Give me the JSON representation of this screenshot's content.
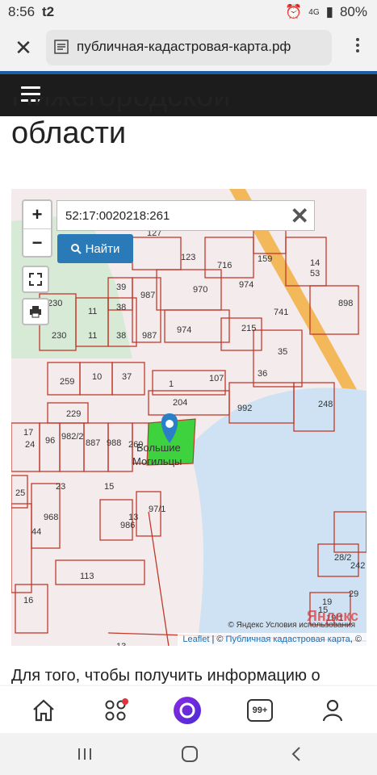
{
  "status": {
    "time": "8:56",
    "carrier": "t2",
    "battery": "80%",
    "net": "4G"
  },
  "browser": {
    "url": "публичная-кадастровая-карта.рф"
  },
  "heading": {
    "line1": "Нижегородской",
    "line2": "области"
  },
  "map": {
    "search_value": "52:17:0020218:261",
    "find_label": "Найти",
    "zoom_in": "+",
    "zoom_out": "−",
    "parcel_label_1": "Большие",
    "parcel_label_2": "Могильцы",
    "attrib_leaflet": "Leaflet",
    "attrib_sep": " | © ",
    "attrib_pkk": "Публичная кадастровая карта",
    "attrib_end": ", ©",
    "yandex_logo": "Яндекс",
    "yandex_copy": "© Яндекс  Условия использования",
    "plot_numbers": [
      "127",
      "123",
      "716",
      "159",
      "14",
      "53",
      "970",
      "974",
      "898",
      "39",
      "230",
      "11",
      "38",
      "987",
      "974",
      "215",
      "741",
      "35",
      "230",
      "11",
      "38",
      "987",
      "259",
      "10",
      "37",
      "1",
      "107",
      "36",
      "204",
      "992",
      "248",
      "229",
      "17",
      "24",
      "96",
      "982/2",
      "887",
      "988",
      "260",
      "25",
      "23",
      "15",
      "968",
      "13",
      "97/1",
      "44",
      "986",
      "113",
      "16",
      "28/2",
      "242",
      "29",
      "19",
      "19/1",
      "13",
      "15"
    ]
  },
  "article": {
    "text": "Для того, чтобы получить информацию о"
  },
  "bottom_nav": {
    "badge": "99+"
  },
  "colors": {
    "accent": "#2a7ab8",
    "parcel_border": "#c0392b",
    "parcel_fill": "#3ed23e",
    "water": "#cfe2f3",
    "forest": "#d7ead5",
    "road": "#f2b24a"
  }
}
